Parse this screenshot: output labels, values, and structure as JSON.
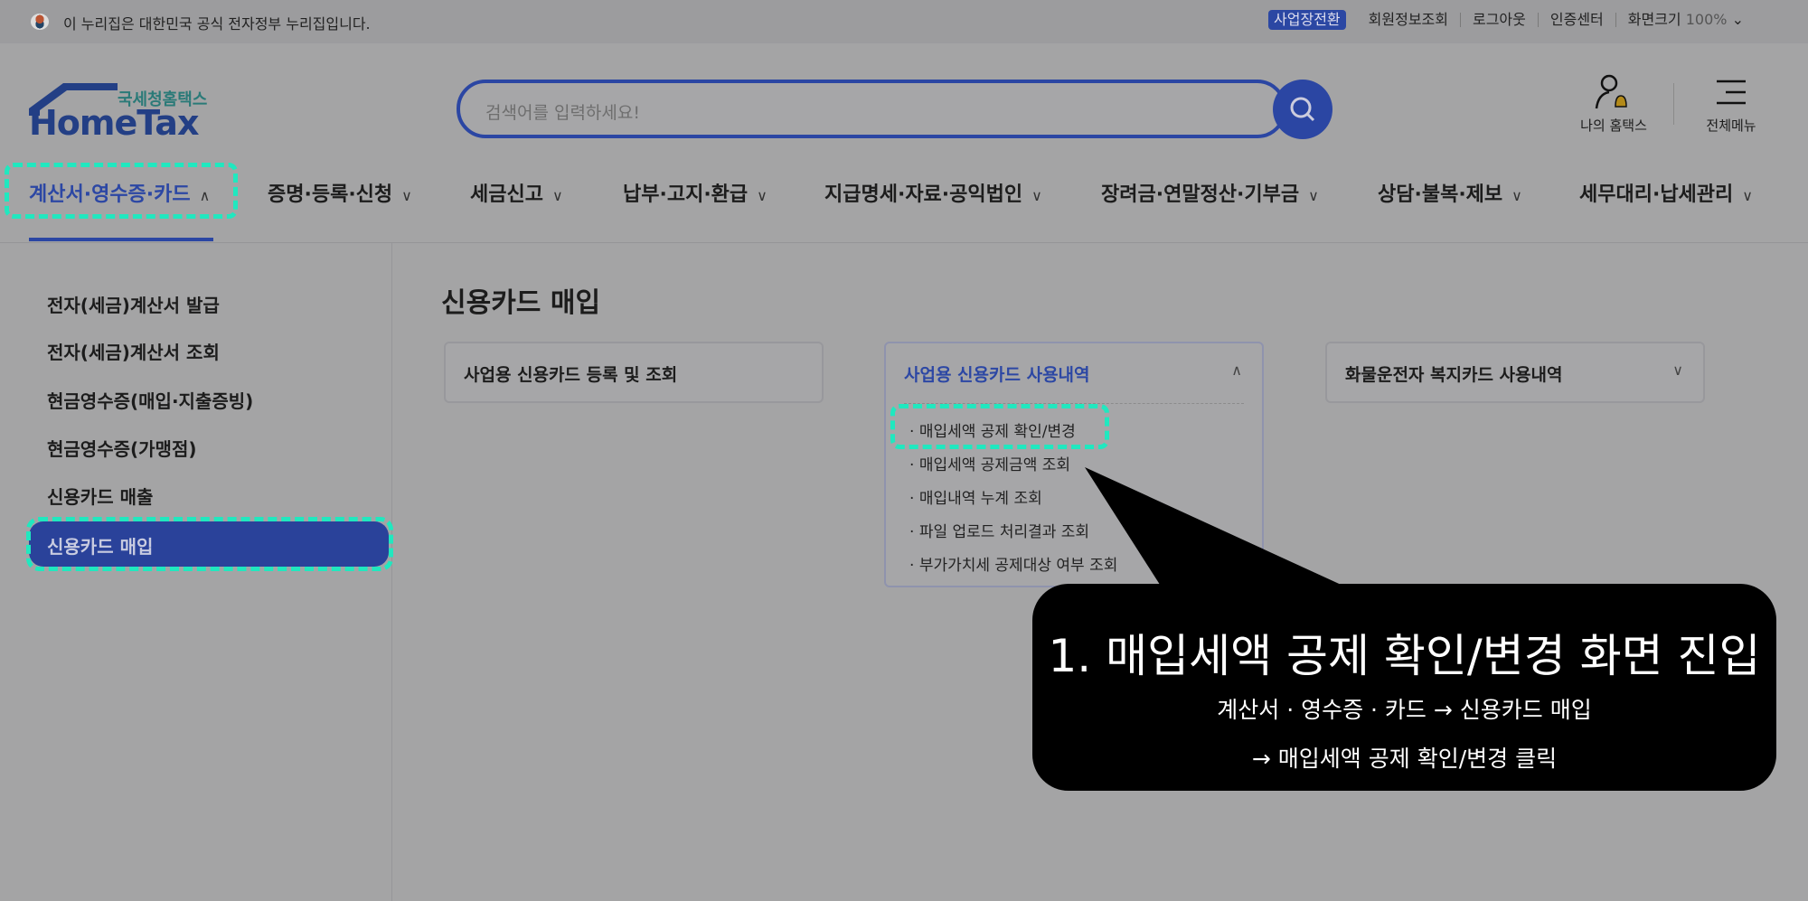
{
  "topbar": {
    "gov_notice": "이 누리집은 대한민국 공식 전자정부 누리집입니다.",
    "business_switch": "사업장전환",
    "links": [
      "회원정보조회",
      "로그아웃",
      "인증센터"
    ],
    "font_size_label": "화면크기",
    "font_size_value": "100%"
  },
  "logo": {
    "kr": "국세청홈택스",
    "en": "HomeTax"
  },
  "search": {
    "placeholder": "검색어를 입력하세요!"
  },
  "header": {
    "my_hometax": "나의 홈택스",
    "all_menu": "전체메뉴"
  },
  "nav": [
    {
      "label": "계산서·영수증·카드",
      "active": true
    },
    {
      "label": "증명·등록·신청"
    },
    {
      "label": "세금신고"
    },
    {
      "label": "납부·고지·환급"
    },
    {
      "label": "지급명세·자료·공익법인"
    },
    {
      "label": "장려금·연말정산·기부금"
    },
    {
      "label": "상담·불복·제보"
    },
    {
      "label": "세무대리·납세관리"
    }
  ],
  "sidebar": {
    "items": [
      "전자(세금)계산서 발급",
      "전자(세금)계산서 조회",
      "현금영수증(매입·지출증빙)",
      "현금영수증(가맹점)",
      "신용카드 매출",
      "신용카드 매입"
    ],
    "active": "신용카드 매입"
  },
  "main": {
    "title": "신용카드 매입",
    "cards": [
      {
        "label": "사업용 신용카드 등록 및 조회"
      },
      {
        "label": "사업용 신용카드 사용내역",
        "expanded": true,
        "items": [
          "매입세액 공제 확인/변경",
          "매입세액 공제금액 조회",
          "매입내역 누계 조회",
          "파일 업로드 처리결과 조회",
          "부가가치세 공제대상 여부 조회"
        ]
      },
      {
        "label": "화물운전자 복지카드 사용내역"
      }
    ]
  },
  "callout": {
    "title": "1. 매입세액 공제 확인/변경 화면 진입",
    "line1": "계산서 · 영수증 · 카드 → 신용카드 매입",
    "line2": "→ 매입세액 공제 확인/변경 클릭"
  },
  "colors": {
    "brand": "#2b46a3",
    "highlight": "#20e8bf",
    "callout_bg": "#000000"
  }
}
